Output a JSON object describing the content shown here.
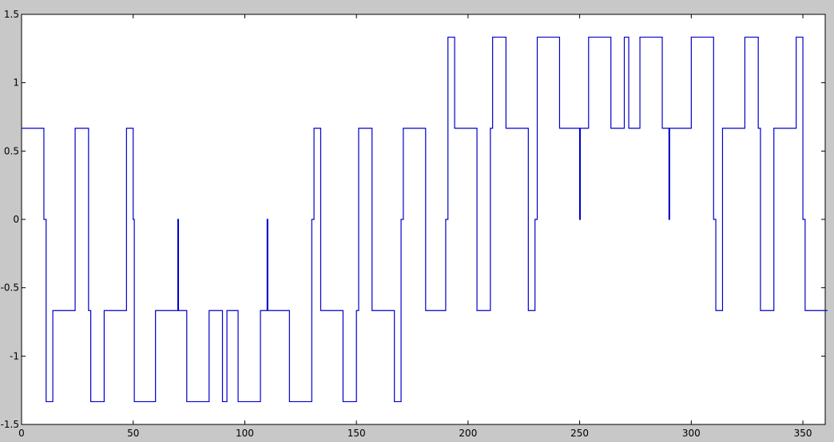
{
  "chart_data": {
    "type": "line",
    "title": "",
    "xlabel": "",
    "ylabel": "",
    "xlim": [
      0,
      360
    ],
    "ylim": [
      -1.5,
      1.5
    ],
    "xticks": [
      0,
      50,
      100,
      150,
      200,
      250,
      300,
      350
    ],
    "yticks": [
      1.5,
      1,
      0.5,
      0,
      -0.5,
      -1,
      -1.5
    ],
    "xtick_labels": [
      "0",
      "50",
      "100",
      "150",
      "200",
      "250",
      "300",
      "350"
    ],
    "ytick_labels": [
      "1.5",
      "1",
      "0.5",
      "0",
      "-0.5",
      "-1",
      "-1.5"
    ],
    "grid": false,
    "line_color": "#0000cc",
    "background_color": "#c8c8c8",
    "axes_color": "#ffffff",
    "series": [
      {
        "values": [
          [
            0,
            0.6667
          ],
          [
            10,
            0.6667
          ],
          [
            10,
            0
          ],
          [
            11,
            0
          ],
          [
            11,
            -1.3333
          ],
          [
            14,
            -1.3333
          ],
          [
            14,
            -0.6667
          ],
          [
            24,
            -0.6667
          ],
          [
            24,
            0.6667
          ],
          [
            30,
            0.6667
          ],
          [
            30,
            -0.6667
          ],
          [
            31,
            -0.6667
          ],
          [
            31,
            -1.3333
          ],
          [
            37,
            -1.3333
          ],
          [
            37,
            -0.6667
          ],
          [
            47,
            -0.6667
          ],
          [
            47,
            0.6667
          ],
          [
            50,
            0.6667
          ],
          [
            50,
            0
          ],
          [
            50.5,
            0
          ],
          [
            50.5,
            -1.3333
          ],
          [
            60,
            -1.3333
          ],
          [
            60,
            -0.6667
          ],
          [
            70,
            -0.6667
          ],
          [
            70,
            0
          ],
          [
            70.3,
            0
          ],
          [
            70.3,
            -0.6667
          ],
          [
            74,
            -0.6667
          ],
          [
            74,
            -1.3333
          ],
          [
            84,
            -1.3333
          ],
          [
            84,
            -0.6667
          ],
          [
            90,
            -0.6667
          ],
          [
            90,
            -1.3333
          ],
          [
            92,
            -1.3333
          ],
          [
            92,
            -0.6667
          ],
          [
            97,
            -0.6667
          ],
          [
            97,
            -1.3333
          ],
          [
            107,
            -1.3333
          ],
          [
            107,
            -0.6667
          ],
          [
            110,
            -0.6667
          ],
          [
            110,
            0
          ],
          [
            110.3,
            0
          ],
          [
            110.3,
            -0.6667
          ],
          [
            120,
            -0.6667
          ],
          [
            120,
            -1.3333
          ],
          [
            130,
            -1.3333
          ],
          [
            130,
            0
          ],
          [
            131,
            0
          ],
          [
            131,
            0.6667
          ],
          [
            134,
            0.6667
          ],
          [
            134,
            -0.6667
          ],
          [
            144,
            -0.6667
          ],
          [
            144,
            -1.3333
          ],
          [
            150,
            -1.3333
          ],
          [
            150,
            -0.6667
          ],
          [
            151,
            -0.6667
          ],
          [
            151,
            0.6667
          ],
          [
            157,
            0.6667
          ],
          [
            157,
            -0.6667
          ],
          [
            167,
            -0.6667
          ],
          [
            167,
            -1.3333
          ],
          [
            170,
            -1.3333
          ],
          [
            170,
            0
          ],
          [
            171,
            0
          ],
          [
            171,
            0.6667
          ],
          [
            181,
            0.6667
          ],
          [
            181,
            -0.6667
          ],
          [
            190,
            -0.6667
          ],
          [
            190,
            0
          ],
          [
            191,
            0
          ],
          [
            191,
            1.3333
          ],
          [
            194,
            1.3333
          ],
          [
            194,
            0.6667
          ],
          [
            204,
            0.6667
          ],
          [
            204,
            -0.6667
          ],
          [
            210,
            -0.6667
          ],
          [
            210,
            0.6667
          ],
          [
            211,
            0.6667
          ],
          [
            211,
            1.3333
          ],
          [
            217,
            1.3333
          ],
          [
            217,
            0.6667
          ],
          [
            227,
            0.6667
          ],
          [
            227,
            -0.6667
          ],
          [
            230,
            -0.6667
          ],
          [
            230,
            0
          ],
          [
            231,
            0
          ],
          [
            231,
            1.3333
          ],
          [
            241,
            1.3333
          ],
          [
            241,
            0.6667
          ],
          [
            250,
            0.6667
          ],
          [
            250,
            0
          ],
          [
            250.3,
            0
          ],
          [
            250.3,
            0.6667
          ],
          [
            254,
            0.6667
          ],
          [
            254,
            1.3333
          ],
          [
            264,
            1.3333
          ],
          [
            264,
            0.6667
          ],
          [
            270,
            0.6667
          ],
          [
            270,
            1.3333
          ],
          [
            272,
            1.3333
          ],
          [
            272,
            0.6667
          ],
          [
            277,
            0.6667
          ],
          [
            277,
            1.3333
          ],
          [
            287,
            1.3333
          ],
          [
            287,
            0.6667
          ],
          [
            290,
            0.6667
          ],
          [
            290,
            0
          ],
          [
            290.3,
            0
          ],
          [
            290.3,
            0.6667
          ],
          [
            300,
            0.6667
          ],
          [
            300,
            1.3333
          ],
          [
            310,
            1.3333
          ],
          [
            310,
            0
          ],
          [
            311,
            0
          ],
          [
            311,
            -0.6667
          ],
          [
            314,
            -0.6667
          ],
          [
            314,
            0.6667
          ],
          [
            324,
            0.6667
          ],
          [
            324,
            1.3333
          ],
          [
            330,
            1.3333
          ],
          [
            330,
            0.6667
          ],
          [
            331,
            0.6667
          ],
          [
            331,
            -0.6667
          ],
          [
            337,
            -0.6667
          ],
          [
            337,
            0.6667
          ],
          [
            347,
            0.6667
          ],
          [
            347,
            1.3333
          ],
          [
            350,
            1.3333
          ],
          [
            350,
            0
          ],
          [
            351,
            0
          ],
          [
            351,
            -0.6667
          ],
          [
            361,
            -0.6667
          ]
        ]
      }
    ]
  }
}
